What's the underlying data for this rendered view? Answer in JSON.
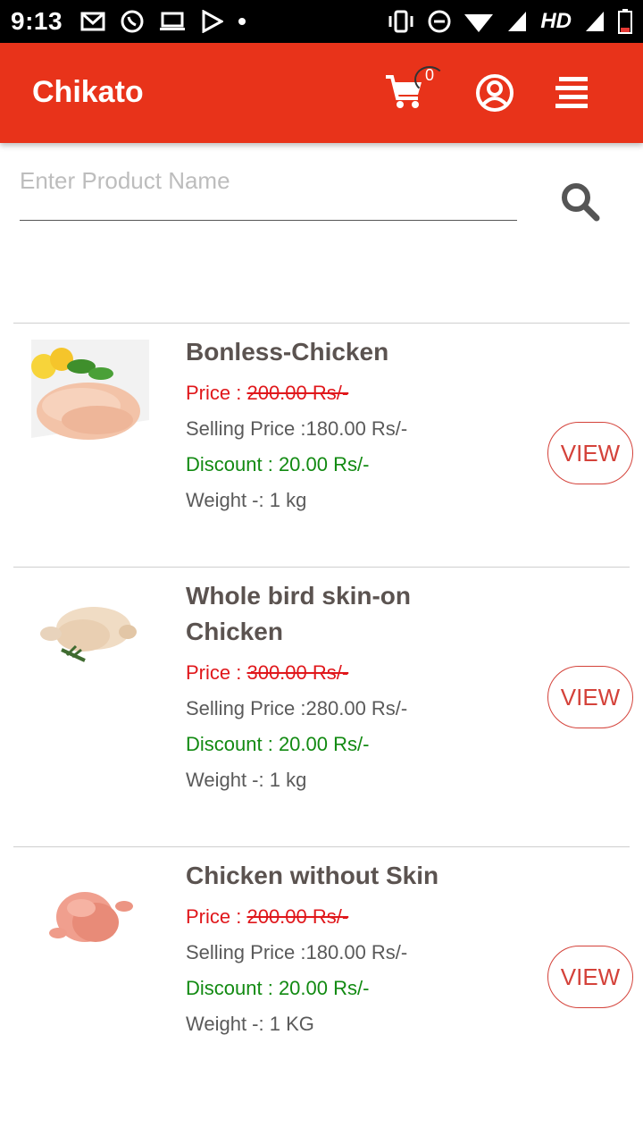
{
  "status_bar": {
    "time": "9:13",
    "network": "HD",
    "icons": [
      "gmail-icon",
      "whatsapp-icon",
      "laptop-icon",
      "play-store-icon",
      "dot-icon",
      "vibrate-icon",
      "dnd-icon",
      "wifi-icon",
      "signal-icon",
      "battery-icon"
    ]
  },
  "app_bar": {
    "brand": "Chikato",
    "cart_count": "0",
    "background": "#e8331a"
  },
  "search": {
    "placeholder": "Enter Product Name",
    "value": ""
  },
  "products": [
    {
      "name": "Bonless-Chicken",
      "price_label": "Price : ",
      "price": "200.00 Rs/-",
      "selling_label": "Selling Price :",
      "selling": "180.00 Rs/-",
      "discount_label": "Discount : ",
      "discount": "20.00 Rs/-",
      "weight_label": "Weight -: ",
      "weight": "1 kg",
      "view": "VIEW"
    },
    {
      "name": "Whole bird skin-on Chicken",
      "price_label": "Price : ",
      "price": "300.00 Rs/-",
      "selling_label": "Selling Price :",
      "selling": "280.00 Rs/-",
      "discount_label": "Discount : ",
      "discount": "20.00 Rs/-",
      "weight_label": "Weight -: ",
      "weight": "1 kg",
      "view": "VIEW"
    },
    {
      "name": "Chicken without Skin",
      "price_label": "Price : ",
      "price": "200.00 Rs/-",
      "selling_label": "Selling Price :",
      "selling": "180.00 Rs/-",
      "discount_label": "Discount : ",
      "discount": "20.00 Rs/-",
      "weight_label": "Weight -: ",
      "weight": "1 KG",
      "view": "VIEW"
    }
  ]
}
